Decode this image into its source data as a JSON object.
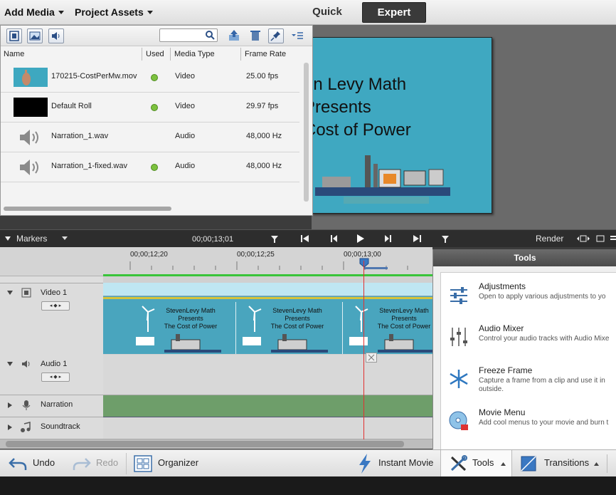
{
  "topbar": {
    "add_media": "Add Media",
    "project_assets": "Project Assets",
    "mode_quick": "Quick",
    "mode_expert": "Expert"
  },
  "assets": {
    "columns": [
      "Name",
      "Used",
      "Media Type",
      "Frame Rate"
    ],
    "rows": [
      {
        "name": "170215-CostPerMw.mov",
        "used": true,
        "type": "Video",
        "rate": "25.00 fps",
        "thumb": "hand-thumbnail"
      },
      {
        "name": "Default Roll",
        "used": true,
        "type": "Video",
        "rate": "29.97 fps",
        "thumb": "black-thumbnail"
      },
      {
        "name": "Narration_1.wav",
        "used": false,
        "type": "Audio",
        "rate": "48,000 Hz",
        "thumb": "speaker-icon"
      },
      {
        "name": "Narration_1-fixed.wav",
        "used": true,
        "type": "Audio",
        "rate": "48,000 Hz",
        "thumb": "speaker-icon"
      }
    ]
  },
  "preview": {
    "lines": [
      "en Levy Math",
      "Presents",
      "Cost of Power"
    ]
  },
  "timeline_bar": {
    "markers": "Markers",
    "timecode": "00;00;13;01",
    "render": "Render"
  },
  "ruler": {
    "ticks": [
      "00;00;12;20",
      "00;00;12;25",
      "00;00;13;00"
    ]
  },
  "tracks": {
    "video1": "Video 1",
    "audio1": "Audio 1",
    "narration": "Narration",
    "soundtrack": "Soundtrack"
  },
  "clip_frame": {
    "lines": [
      "StevenLevy Math",
      "Presents",
      "The Cost of Power"
    ]
  },
  "tools": {
    "title": "Tools",
    "items": [
      {
        "name": "Adjustments",
        "desc": "Open to apply various adjustments to yo",
        "icon": "sliders-icon"
      },
      {
        "name": "Audio Mixer",
        "desc": "Control your audio tracks with Audio Mixe",
        "icon": "mixer-icon"
      },
      {
        "name": "Freeze Frame",
        "desc": "Capture a frame from a clip and use it in outside.",
        "icon": "snowflake-icon"
      },
      {
        "name": "Movie Menu",
        "desc": "Add cool menus to your movie and burn t",
        "icon": "disc-icon"
      }
    ]
  },
  "bottombar": {
    "undo": "Undo",
    "redo": "Redo",
    "organizer": "Organizer",
    "instant_movie": "Instant Movie",
    "tools": "Tools",
    "transitions": "Transitions"
  }
}
